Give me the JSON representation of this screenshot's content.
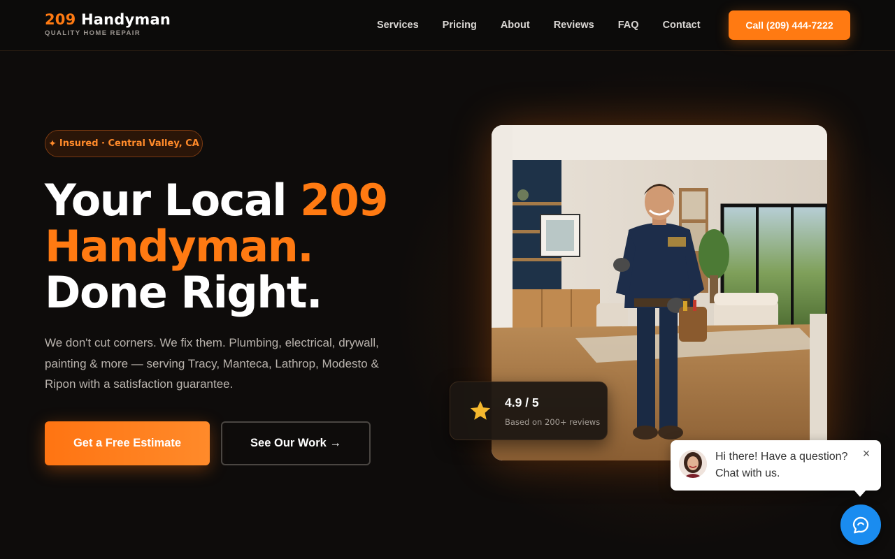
{
  "header": {
    "brand_number": "209",
    "brand_word": "Handyman",
    "brand_tagline": "QUALITY HOME REPAIR",
    "nav": [
      {
        "label": "Services"
      },
      {
        "label": "Pricing"
      },
      {
        "label": "About"
      },
      {
        "label": "Reviews"
      },
      {
        "label": "FAQ"
      },
      {
        "label": "Contact"
      }
    ],
    "call_button": "Call (209) 444-7222"
  },
  "hero": {
    "badge_icon": "✦",
    "badge_text": "Insured · Central Valley, CA",
    "headline_part1": "Your Local ",
    "headline_part2": "209 Handyman.",
    "headline_part3": "Done Right.",
    "lead": "We don't cut corners. We fix them. Plumbing, electrical, drywall, painting & more — serving Tracy, Manteca, Lathrop, Modesto & Ripon with a satisfaction guarantee.",
    "primary_cta": "Get a Free Estimate",
    "secondary_cta": "See Our Work →"
  },
  "rating": {
    "score": "4.9 / 5",
    "subtitle": "Based on 200+ reviews",
    "icon": "star-icon"
  },
  "chat": {
    "message_line1": "Hi there! Have a question?",
    "message_line2": "Chat with us.",
    "close_icon": "×",
    "launcher_icon": "chat-icon"
  },
  "colors": {
    "accent": "#ff7a12",
    "background": "#0e0c0b",
    "chat_blue": "#1a8cf0"
  }
}
